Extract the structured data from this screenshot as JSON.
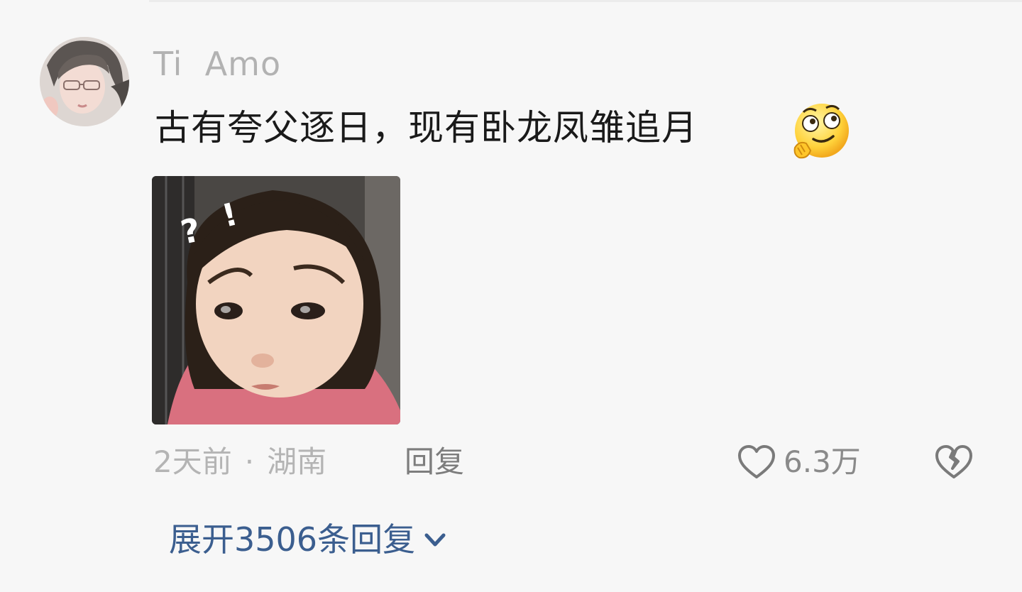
{
  "comment": {
    "username": "Ti  Amo",
    "text": "古有夸父逐日，现有卧龙凤雏追月",
    "emoji_icon": "smirk-emoji",
    "sticker": {
      "marks": [
        "?",
        "!"
      ]
    },
    "time": "2天前",
    "separator": "·",
    "location": "湖南",
    "reply_label": "回复",
    "like_count": "6.3万",
    "expand_label": "展开3506条回复"
  },
  "colors": {
    "background": "#f7f7f7",
    "username": "#b2b2b2",
    "text": "#1a1a1a",
    "meta": "#b4b4b4",
    "link": "#3b5e8f"
  }
}
